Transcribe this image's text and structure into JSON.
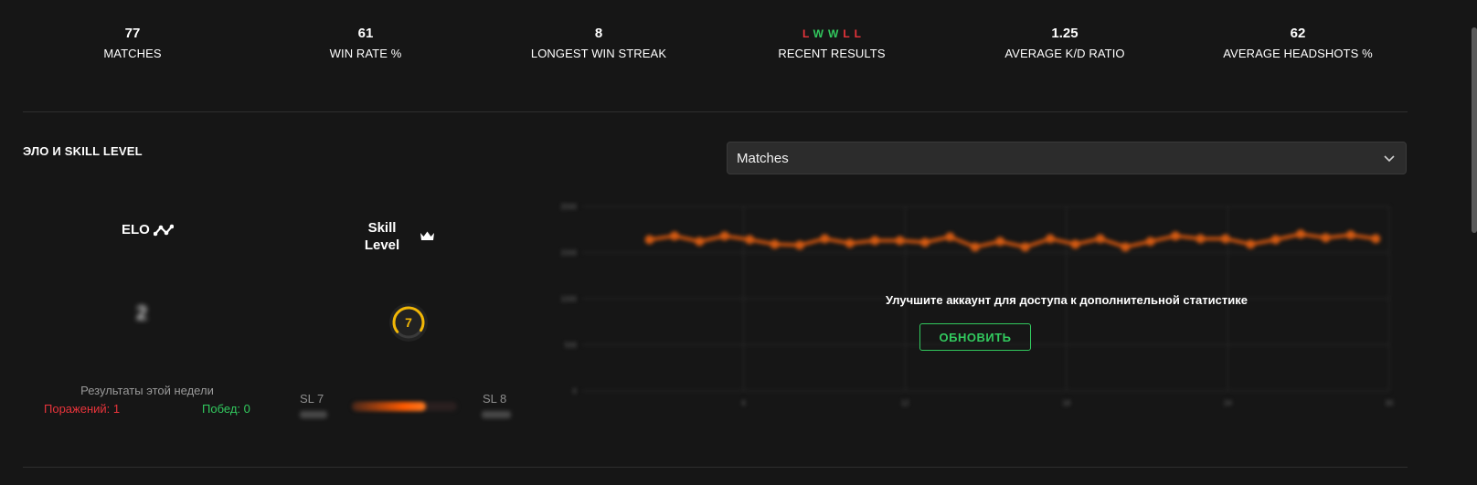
{
  "stats": {
    "matches": {
      "value": "77",
      "label": "MATCHES"
    },
    "win_rate": {
      "value": "61",
      "label": "WIN RATE %"
    },
    "longest_win_streak": {
      "value": "8",
      "label": "LONGEST WIN STREAK"
    },
    "recent_results": {
      "results": [
        "L",
        "W",
        "W",
        "L",
        "L"
      ],
      "label": "RECENT RESULTS"
    },
    "avg_kd": {
      "value": "1.25",
      "label": "AVERAGE K/D RATIO"
    },
    "avg_headshots": {
      "value": "62",
      "label": "AVERAGE HEADSHOTS %"
    }
  },
  "section_title": "ЭЛО И SKILL LEVEL",
  "dropdown": {
    "selected": "Matches"
  },
  "elo": {
    "label": "ELO",
    "icon": "trend-icon",
    "value": "2"
  },
  "skill": {
    "label_line1": "Skill",
    "label_line2": "Level",
    "icon": "crown-icon",
    "level": "7",
    "gauge_fraction": 0.7
  },
  "week": {
    "title": "Результаты этой недели",
    "losses": "Поражений: 1",
    "wins": "Побед: 0"
  },
  "skill_progress": {
    "left_label": "SL 7",
    "right_label": "SL 8",
    "fraction": 0.7
  },
  "upgrade": {
    "message": "Улучшите аккаунт для доступа к дополнительной статистике",
    "button": "ОБНОВИТЬ"
  },
  "colors": {
    "loss": "#e8343b",
    "win": "#32c95e",
    "accent": "#ff5a00",
    "gauge": "#f2b705"
  },
  "chart_data": {
    "type": "line",
    "ylim": [
      0,
      2000
    ],
    "yticks": [
      0,
      500,
      1000,
      1500,
      2000
    ],
    "xlim": [
      0,
      30
    ],
    "xticks": [
      6,
      12,
      18,
      24,
      30
    ],
    "y": [
      1640,
      1680,
      1620,
      1680,
      1640,
      1590,
      1580,
      1650,
      1600,
      1630,
      1630,
      1610,
      1670,
      1560,
      1620,
      1560,
      1650,
      1590,
      1650,
      1560,
      1620,
      1680,
      1650,
      1650,
      1590,
      1640,
      1700,
      1660,
      1690,
      1650
    ]
  }
}
